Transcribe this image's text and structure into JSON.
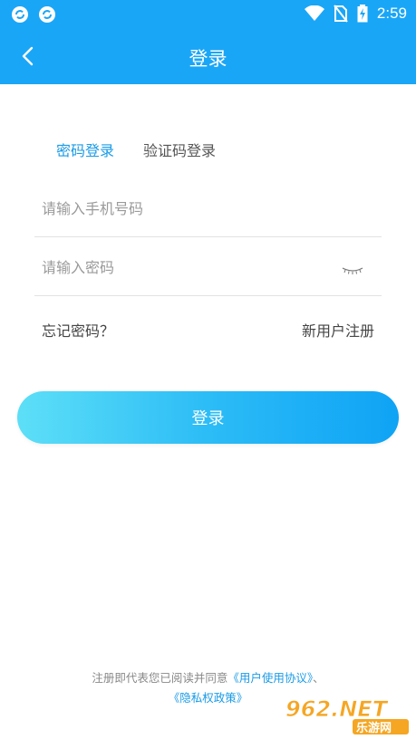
{
  "status_bar": {
    "left_icons": [
      "sync-icon",
      "sync-icon"
    ],
    "right_icons": [
      "wifi-icon",
      "no-sim-icon",
      "battery-charging-icon"
    ],
    "time": "2:59"
  },
  "app_bar": {
    "back_icon": "chevron-left-icon",
    "title": "登录"
  },
  "tabs": [
    {
      "label": "密码登录",
      "active": true
    },
    {
      "label": "验证码登录",
      "active": false
    }
  ],
  "form": {
    "phone_placeholder": "请输入手机号码",
    "phone_value": "",
    "password_placeholder": "请输入密码",
    "password_value": "",
    "eye_icon": "eye-closed-icon"
  },
  "links": {
    "forgot_password": "忘记密码？",
    "register": "新用户注册"
  },
  "login_button": "登录",
  "agreement": {
    "prefix": "注册即代表您已阅读并同意",
    "user_agreement": "《用户使用协议》",
    "separator": "、",
    "privacy_policy": "《隐私权政策》"
  },
  "watermark": {
    "text_top": "962.NET",
    "text_bottom": "乐游网"
  },
  "colors": {
    "primary": "#1aa6f7",
    "active_tab": "#1a9be6",
    "button_gradient_start": "#5ddff7",
    "button_gradient_end": "#0fa3f5"
  }
}
